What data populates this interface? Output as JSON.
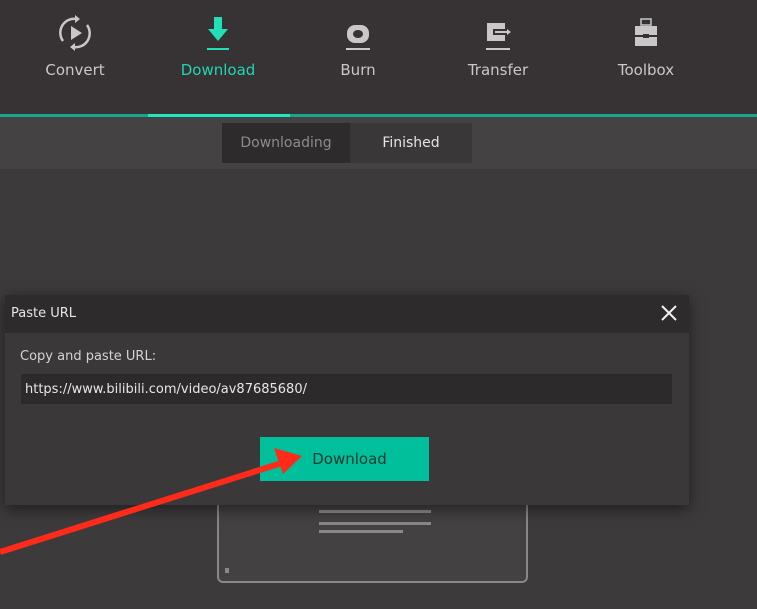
{
  "nav": {
    "items": [
      {
        "label": "Convert"
      },
      {
        "label": "Download"
      },
      {
        "label": "Burn"
      },
      {
        "label": "Transfer"
      },
      {
        "label": "Toolbox"
      }
    ],
    "active": "Download"
  },
  "subtabs": {
    "items": [
      {
        "label": "Downloading"
      },
      {
        "label": "Finished"
      }
    ],
    "selected": "Downloading"
  },
  "dialog": {
    "title": "Paste URL",
    "prompt": "Copy and paste URL:",
    "url_value": "https://www.bilibili.com/video/av87685680/",
    "download_label": "Download"
  },
  "colors": {
    "accent": "#00bf9a",
    "annotation_arrow": "#ff2a1a"
  }
}
